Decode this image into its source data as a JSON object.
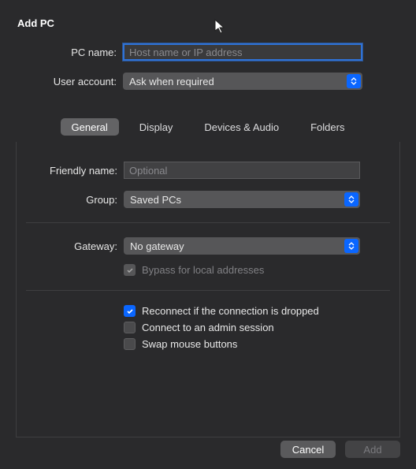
{
  "title": "Add PC",
  "top": {
    "pc_name_label": "PC name:",
    "pc_name_placeholder": "Host name or IP address",
    "pc_name_value": "",
    "user_account_label": "User account:",
    "user_account_value": "Ask when required"
  },
  "tabs": {
    "general": "General",
    "display": "Display",
    "devices": "Devices & Audio",
    "folders": "Folders"
  },
  "general": {
    "friendly_name_label": "Friendly name:",
    "friendly_name_placeholder": "Optional",
    "friendly_name_value": "",
    "group_label": "Group:",
    "group_value": "Saved PCs",
    "gateway_label": "Gateway:",
    "gateway_value": "No gateway",
    "bypass_label": "Bypass for local addresses",
    "reconnect_label": "Reconnect if the connection is dropped",
    "admin_label": "Connect to an admin session",
    "swap_label": "Swap mouse buttons"
  },
  "buttons": {
    "cancel": "Cancel",
    "add": "Add"
  }
}
